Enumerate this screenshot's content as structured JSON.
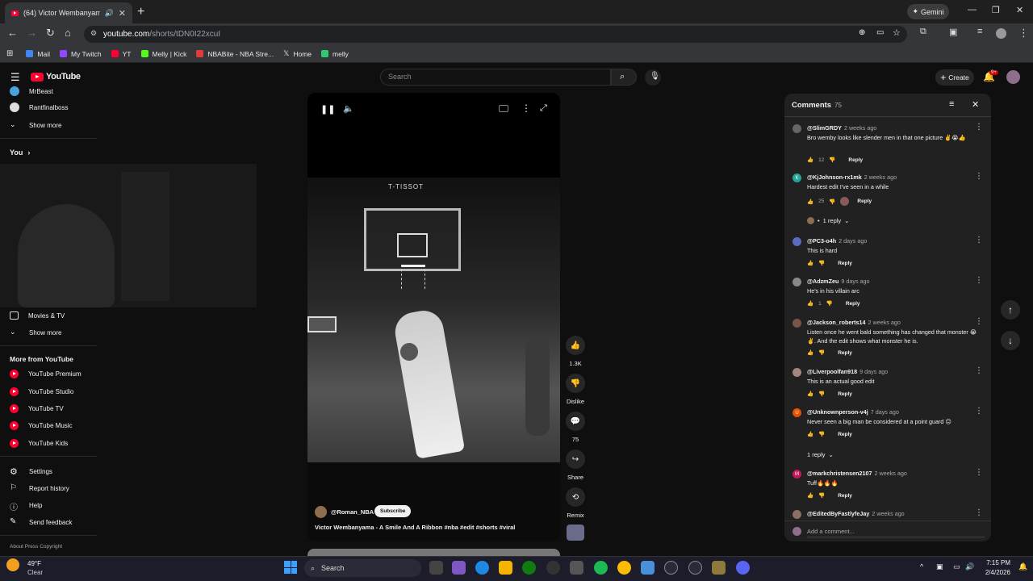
{
  "browser": {
    "tab_title": "(64) Victor Wembanyama -",
    "url_host": "youtube.com",
    "url_path": "/shorts/tDN0I22xcuI",
    "gemini_label": "Gemini",
    "bookmarks": [
      {
        "label": "Mail",
        "color": "#4285f4"
      },
      {
        "label": "My Twitch",
        "color": "#9146ff"
      },
      {
        "label": "YT",
        "color": "#ff0033"
      },
      {
        "label": "Melly | Kick",
        "color": "#53fc18"
      },
      {
        "label": "NBABite - NBA Stre...",
        "color": "#e23b3b"
      },
      {
        "label": "Home",
        "color": "#ffffff"
      },
      {
        "label": "melly",
        "color": "#2ecc71"
      }
    ]
  },
  "youtube": {
    "logo": "YouTube",
    "search_placeholder": "Search",
    "create_label": "Create",
    "notif_badge": "9+"
  },
  "sidebar": {
    "subs": [
      "MrBeast",
      "Rantfinalboss"
    ],
    "show_more": "Show more",
    "you": "You",
    "movies": "Movies & TV",
    "show_more_2": "Show more",
    "more_heading": "More from YouTube",
    "more_items": [
      "YouTube Premium",
      "YouTube Studio",
      "YouTube TV",
      "YouTube Music",
      "YouTube Kids"
    ],
    "settings": [
      "Settings",
      "Report history",
      "Help",
      "Send feedback"
    ],
    "footer": "About  Press  Copyright"
  },
  "short": {
    "channel": "@Roman_NBA",
    "subscribe": "Subscribe",
    "title": "Victor Wembanyama - A Smile And A Ribbon #nba #edit #shorts #viral",
    "likes": "1.3K",
    "dislike": "Dislike",
    "comment_count": "75",
    "share": "Share",
    "remix": "Remix",
    "scene_text": "T-TISSOT"
  },
  "comments_panel": {
    "title": "Comments",
    "count": "75",
    "add_placeholder": "Add a comment...",
    "items": [
      {
        "author": "@SlimGRDY",
        "age": "2 weeks ago",
        "text": "Bro wemby looks like slender men in that one picture ✌️😭👍",
        "likes": "12",
        "avatar_color": "#666",
        "avatar_letter": ""
      },
      {
        "author": "@KjJohnson-rx1mk",
        "age": "2 weeks ago",
        "text": "Hardest edit I've seen in a while",
        "likes": "25",
        "avatar_color": "#26a69a",
        "avatar_letter": "K",
        "replies": "1 reply"
      },
      {
        "author": "@PC3-o4h",
        "age": "2 days ago",
        "text": "This is hard",
        "likes": "",
        "avatar_color": "#5c6bc0",
        "avatar_letter": ""
      },
      {
        "author": "@AdzmZeu",
        "age": "9 days ago",
        "text": "He's in his villain arc",
        "likes": "1",
        "avatar_color": "#888",
        "avatar_letter": ""
      },
      {
        "author": "@Jackson_roberts14",
        "age": "2 weeks ago",
        "text": "Listen once he went bald something has changed that monster 😭✌️. And the edit shows what monster he is.",
        "likes": "",
        "avatar_color": "#795548",
        "avatar_letter": ""
      },
      {
        "author": "@Liverpoolfan918",
        "age": "9 days ago",
        "text": "This is an actual good edit",
        "likes": "",
        "avatar_color": "#a1887f",
        "avatar_letter": ""
      },
      {
        "author": "@Unknownperson-v4j",
        "age": "7 days ago",
        "text": "Never seen a big man be considered at a point guard 😐",
        "likes": "",
        "avatar_color": "#e65100",
        "avatar_letter": "U",
        "replies": "1 reply"
      },
      {
        "author": "@markchristensen2107",
        "age": "2 weeks ago",
        "text": "Tuff🔥🔥🔥",
        "likes": "",
        "avatar_color": "#c2185b",
        "avatar_letter": "M"
      },
      {
        "author": "@EditedByFastlyfeJay",
        "age": "2 weeks ago",
        "text": "",
        "likes": "",
        "avatar_color": "#8d6e63",
        "avatar_letter": ""
      }
    ],
    "reply_label": "Reply"
  },
  "taskbar": {
    "temp": "49°F",
    "weather": "Clear",
    "search": "Search",
    "time": "7:15 PM",
    "date": "2/4/2026"
  }
}
